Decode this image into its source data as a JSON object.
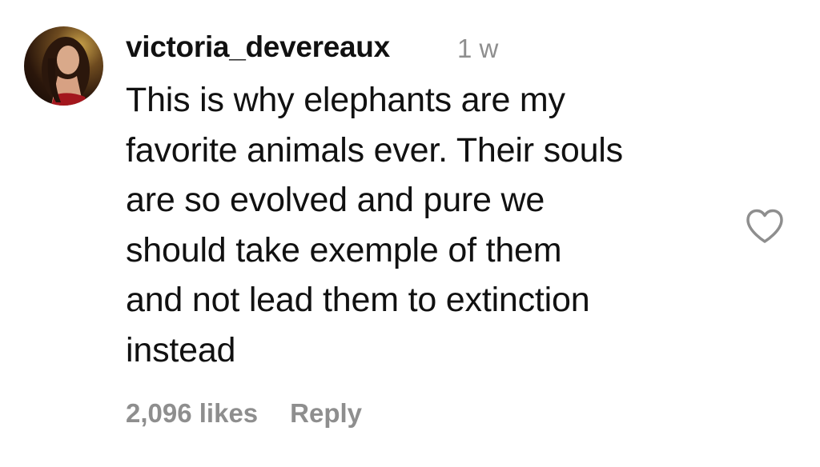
{
  "comment": {
    "username": "victoria_devereaux",
    "timestamp": "1 w",
    "body_lines": [
      "This is why elephants are my",
      "favorite animals ever. Their souls",
      "are so evolved and pure we",
      "should take exemple of them",
      "and not lead them to extinction",
      "instead"
    ],
    "likes": "2,096 likes",
    "reply_label": "Reply"
  },
  "icons": {
    "like": "heart-outline-icon"
  },
  "colors": {
    "text": "#111111",
    "secondary": "#8e8e8e",
    "background": "#ffffff"
  }
}
